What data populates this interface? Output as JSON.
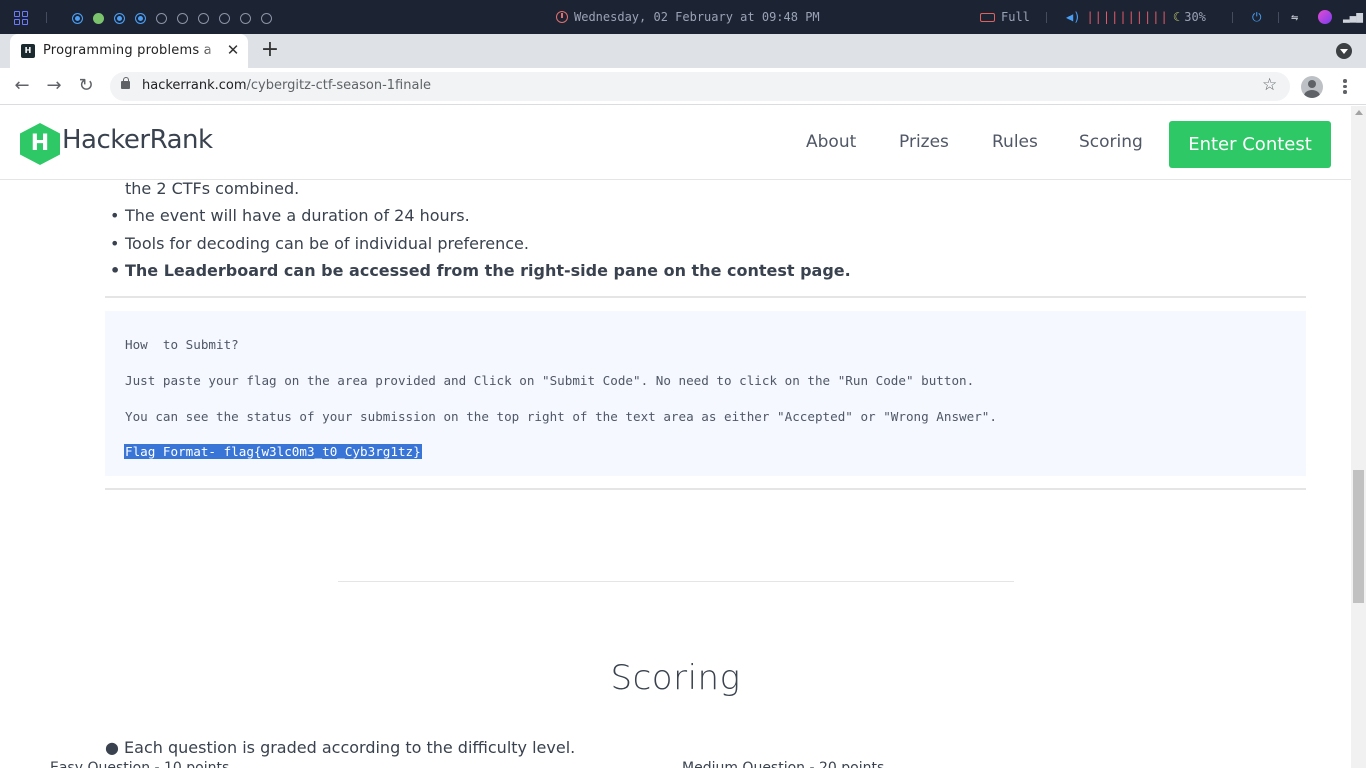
{
  "os_bar": {
    "clock_text": "Wednesday, 02 February at 09:48 PM",
    "battery_label": "Full",
    "volume_bars": "||||||||||",
    "brightness_label": "30%"
  },
  "browser": {
    "tab_title": "Programming problems a",
    "url_domain": "hackerrank.com",
    "url_path": "/cybergitz-ctf-season-1finale"
  },
  "site": {
    "logo_text": "HackerRank",
    "logo_letter": "H",
    "nav": [
      "About",
      "Prizes",
      "Rules",
      "Scoring"
    ],
    "cta_label": "Enter Contest"
  },
  "rules": {
    "continued_text": "the 2 CTFs combined.",
    "items": [
      "The event will have a duration of 24 hours.",
      "Tools for decoding can be of individual preference.",
      "The Leaderboard can be accessed from the right-side pane on the contest page."
    ],
    "bullet": "•"
  },
  "submit_box": {
    "heading": "How  to Submit?",
    "line1": "Just paste your flag on the area provided and Click on \"Submit Code\". No need to click on the \"Run Code\" button.",
    "line2": "You can see the status of your submission on the top right of the text area as either \"Accepted\" or \"Wrong Answer\".",
    "flag_format": "Flag Format- flag{w3lc0m3_t0_Cyb3rg1tz}"
  },
  "scoring": {
    "heading": "Scoring",
    "line1": "● Each question is graded according to the difficulty level.",
    "cut_left": "Easy Question - 10 points",
    "cut_right": "Medium Question - 20 points"
  },
  "colors": {
    "brand_green": "#2ec866",
    "text_dark": "#39424e",
    "selection_blue": "#3875d7",
    "os_bar_bg": "#1c2333"
  }
}
